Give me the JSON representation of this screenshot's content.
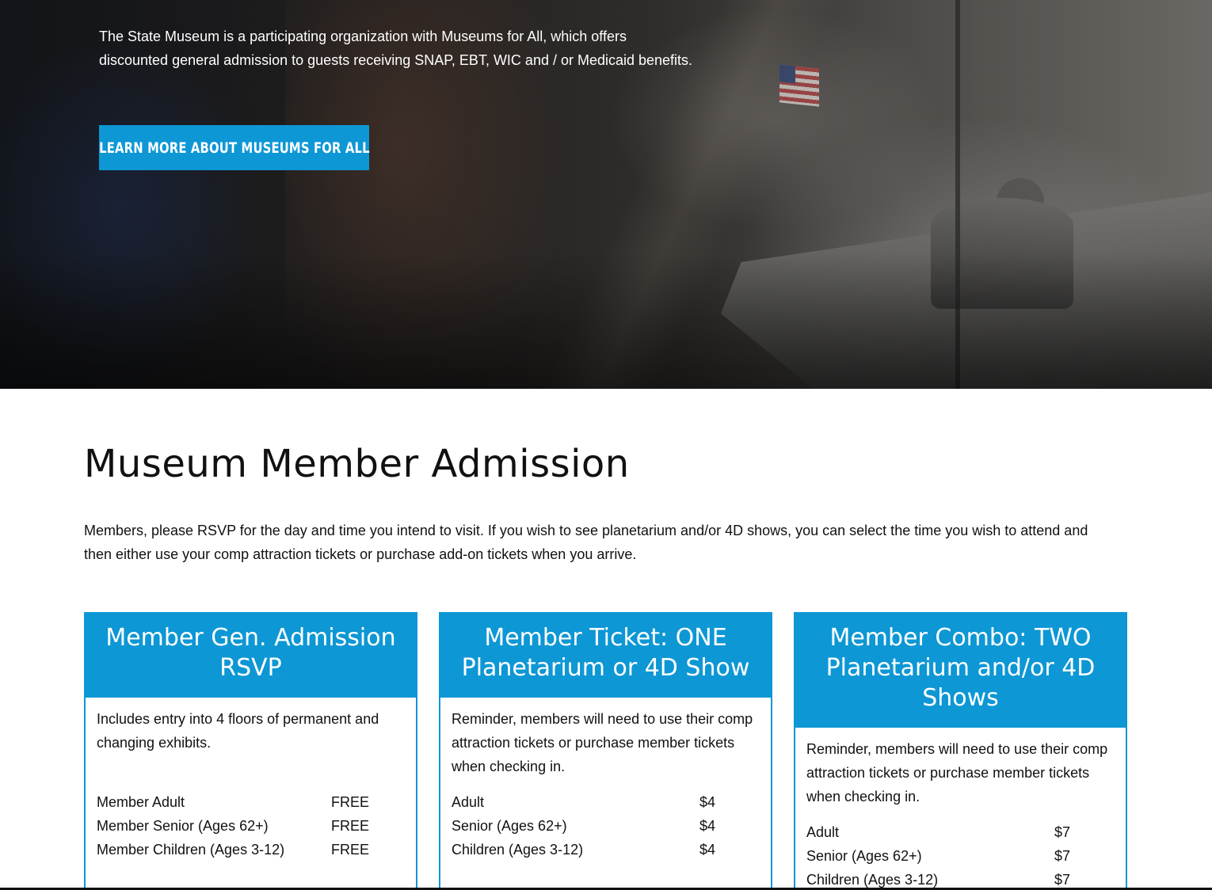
{
  "hero": {
    "text_line1": "The State Museum is a participating organization with Museums for All, which offers",
    "text_line2": "discounted general admission to guests receiving SNAP, EBT, WIC and / or Medicaid benefits.",
    "button_label": "LEARN MORE ABOUT MUSEUMS FOR ALL"
  },
  "main": {
    "title": "Museum Member Admission",
    "intro_line1": "Members, please RSVP for the day and time you intend to visit. If you wish to see planetarium and/or 4D shows, you can select the time you wish to attend and",
    "intro_line2": "then either use your comp attraction tickets or purchase add-on tickets when you arrive."
  },
  "cards": [
    {
      "title_line1": "Member Gen. Admission",
      "title_line2": "RSVP",
      "desc_line1": "Includes entry into 4 floors of permanent and",
      "desc_line2": "changing exhibits.",
      "rows": [
        {
          "label": "Member Adult",
          "value": "FREE"
        },
        {
          "label": "Member Senior (Ages 62+)",
          "value": "FREE"
        },
        {
          "label": "Member Children (Ages 3-12)",
          "value": "FREE"
        }
      ]
    },
    {
      "title_line1": "Member Ticket: ONE",
      "title_line2": "Planetarium or 4D Show",
      "desc_line1": "Reminder, members will need to use their comp",
      "desc_line2": "attraction tickets or purchase member tickets",
      "desc_line3": "when checking in.",
      "rows": [
        {
          "label": "Adult",
          "value": "$4"
        },
        {
          "label": "Senior (Ages 62+)",
          "value": "$4"
        },
        {
          "label": "Children (Ages 3-12)",
          "value": "$4"
        }
      ]
    },
    {
      "title_line1": "Member Combo: TWO",
      "title_line2": "Planetarium and/or 4D",
      "title_line3": "Shows",
      "desc_line1": "Reminder, members will need to use their comp",
      "desc_line2": "attraction tickets or purchase member tickets",
      "desc_line3": "when checking in.",
      "rows": [
        {
          "label": "Adult",
          "value": "$7"
        },
        {
          "label": "Senior (Ages 62+)",
          "value": "$7"
        },
        {
          "label": "Children (Ages 3-12)",
          "value": "$7"
        }
      ]
    }
  ],
  "colors": {
    "accent": "#0d97d5",
    "text": "#111111",
    "background": "#ffffff"
  }
}
